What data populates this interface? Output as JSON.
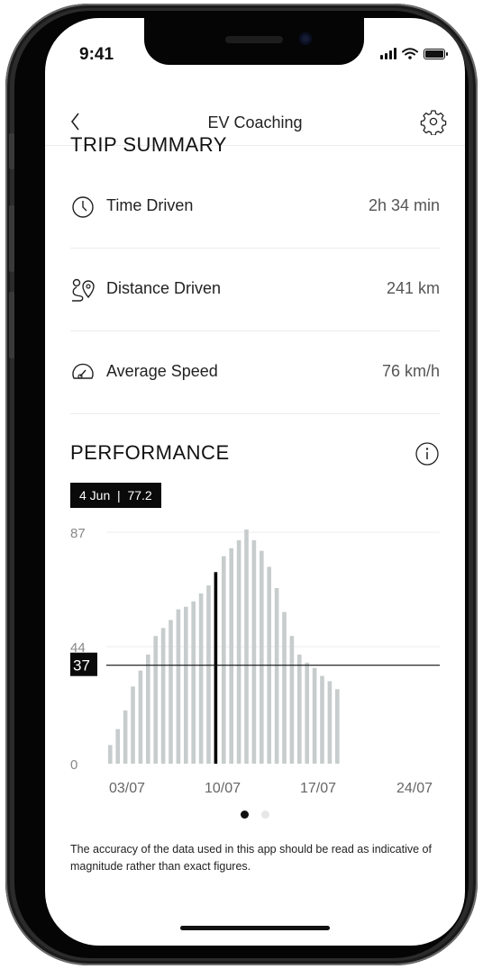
{
  "status_bar": {
    "time": "9:41"
  },
  "header": {
    "title": "EV Coaching"
  },
  "trip_summary": {
    "title": "TRIP SUMMARY",
    "rows": [
      {
        "icon": "clock-icon",
        "label": "Time Driven",
        "value": "2h 34 min"
      },
      {
        "icon": "route-icon",
        "label": "Distance Driven",
        "value": "241 km"
      },
      {
        "icon": "speedometer-icon",
        "label": "Average Speed",
        "value": "76 km/h"
      }
    ]
  },
  "performance": {
    "title": "PERFORMANCE",
    "tooltip": {
      "date": "4 Jun",
      "separator": "|",
      "value": "77.2"
    },
    "average_label": "37"
  },
  "chart_data": {
    "type": "bar",
    "x_tick_labels": [
      "03/07",
      "10/07",
      "17/07",
      "24/07"
    ],
    "y_tick_labels": [
      "87",
      "44",
      "0"
    ],
    "ylim": [
      0,
      87
    ],
    "average_line": 37,
    "selected_index": 14,
    "values": [
      7,
      13,
      20,
      29,
      35,
      41,
      48,
      51,
      54,
      58,
      59,
      61,
      64,
      67,
      72,
      78,
      81,
      84,
      88,
      84,
      80,
      74,
      66,
      57,
      48,
      41,
      38,
      36,
      33,
      31,
      28
    ],
    "colors": {
      "bar": "#c7cccc",
      "selected": "#000000",
      "avg_line": "#111111"
    }
  },
  "pager": {
    "count": 2,
    "active": 0
  },
  "disclaimer": "The accuracy of the data used in this app should be read as indicative of magnitude rather than exact figures."
}
